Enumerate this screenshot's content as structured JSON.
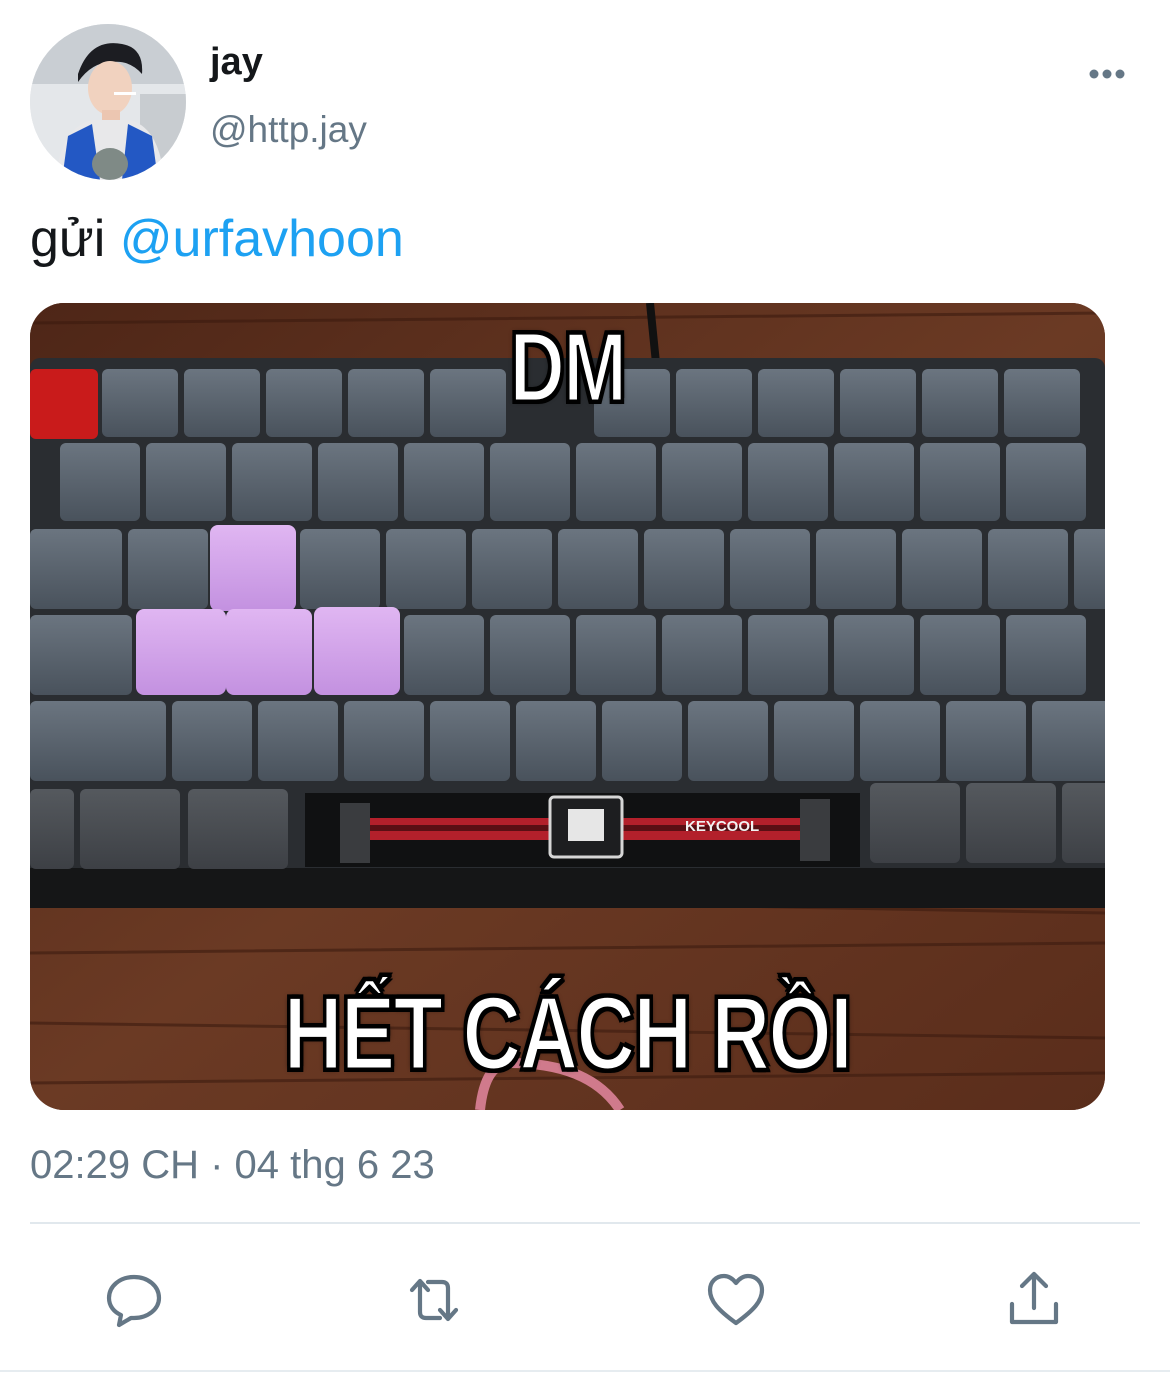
{
  "tweet": {
    "display_name": "jay",
    "handle": "@http.jay",
    "text_prefix": "gửi",
    "mention": "@urfavhoon",
    "timestamp": "02:29 CH · 04 thg 6 23"
  },
  "media": {
    "caption_top": "DM",
    "caption_bottom": "HẾT CÁCH RỒI",
    "keyboard_brand": "KEYCOOL"
  },
  "icons": {
    "more": "more-horizontal-icon",
    "reply": "reply-icon",
    "retweet": "retweet-icon",
    "like": "heart-icon",
    "share": "share-icon"
  },
  "colors": {
    "accent": "#1da1f2",
    "secondary_text": "#657786",
    "primary_text": "#14171a",
    "divider": "#e1e8ed"
  }
}
